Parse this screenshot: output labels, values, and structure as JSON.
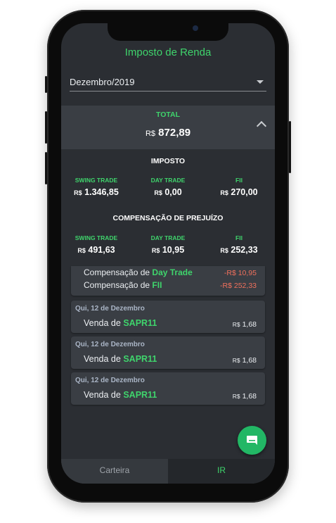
{
  "header": {
    "title": "Imposto de Renda"
  },
  "month_select": {
    "value": "Dezembro/2019"
  },
  "total": {
    "label": "TOTAL",
    "currency": "R$",
    "amount": "872,89"
  },
  "imposto": {
    "title": "IMPOSTO",
    "columns": [
      {
        "label": "SWING TRADE",
        "currency": "R$",
        "amount": "1.346,85"
      },
      {
        "label": "DAY TRADE",
        "currency": "R$",
        "amount": "0,00"
      },
      {
        "label": "FII",
        "currency": "R$",
        "amount": "270,00"
      }
    ]
  },
  "compensacao": {
    "title": "COMPENSAÇÃO DE PREJUÍZO",
    "columns": [
      {
        "label": "SWING TRADE",
        "currency": "R$",
        "amount": "491,63"
      },
      {
        "label": "DAY TRADE",
        "currency": "R$",
        "amount": "10,95"
      },
      {
        "label": "FII",
        "currency": "R$",
        "amount": "252,33"
      }
    ]
  },
  "comp_card": {
    "rows": [
      {
        "prefix": "Compensação de",
        "type": "Day Trade",
        "amount": "-R$ 10,95"
      },
      {
        "prefix": "Compensação de",
        "type": "FII",
        "amount": "-R$ 252,33"
      }
    ]
  },
  "transactions": [
    {
      "date": "Qui, 12 de Dezembro",
      "prefix": "Venda de",
      "ticker": "SAPR11",
      "currency": "R$",
      "amount": "1,68"
    },
    {
      "date": "Qui, 12 de Dezembro",
      "prefix": "Venda de",
      "ticker": "SAPR11",
      "currency": "R$",
      "amount": "1,68"
    },
    {
      "date": "Qui, 12 de Dezembro",
      "prefix": "Venda de",
      "ticker": "SAPR11",
      "currency": "R$",
      "amount": "1,68"
    }
  ],
  "tabs": [
    {
      "label": "Carteira"
    },
    {
      "label": "IR"
    }
  ],
  "colors": {
    "accent": "#3fd46c",
    "negative": "#f0705c",
    "fab": "#22b765",
    "background": "#2b2e33"
  },
  "icons": {
    "fab": "chat-icon",
    "select": "caret-down-icon",
    "collapse": "chevron-up-icon"
  }
}
